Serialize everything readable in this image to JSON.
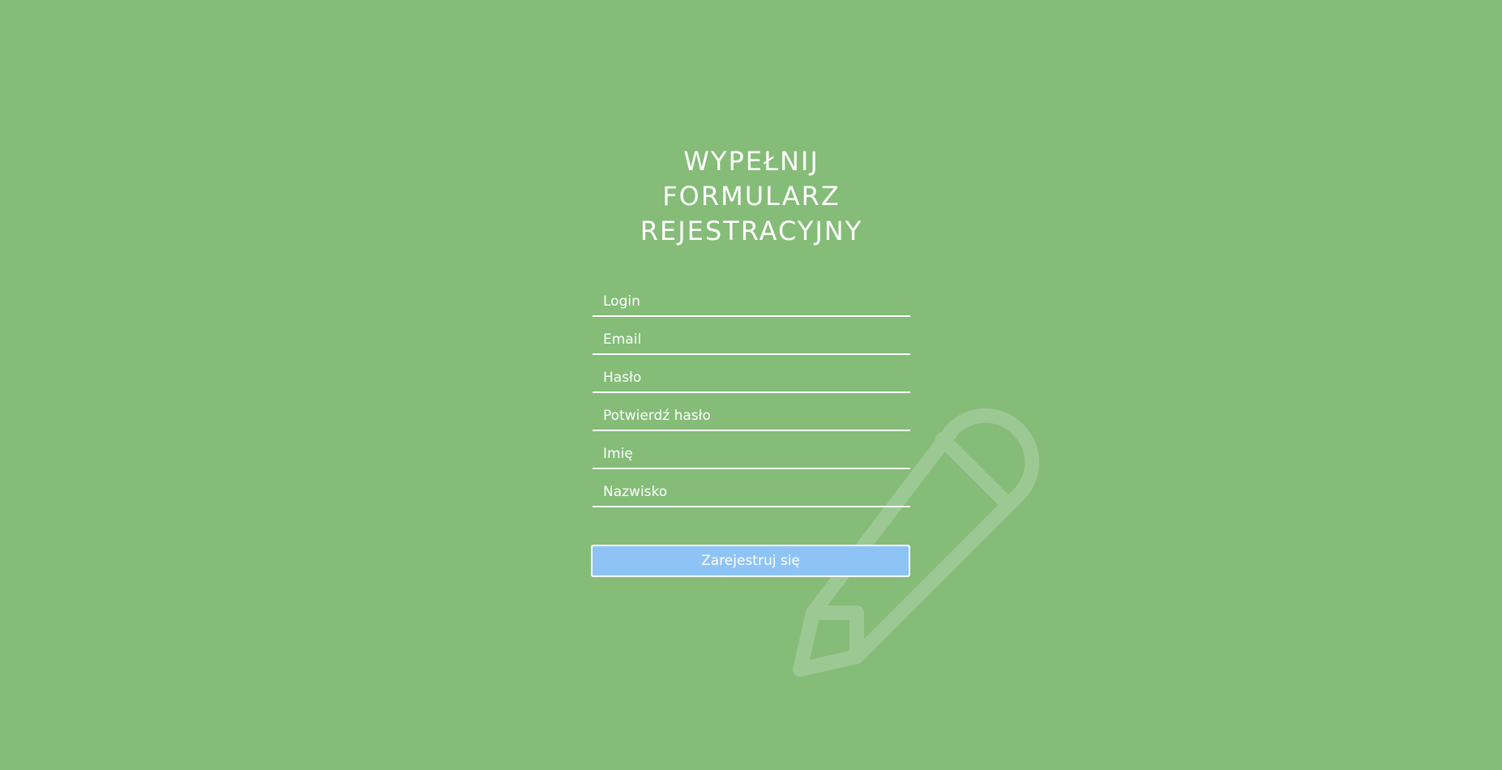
{
  "background_color": "#84bc78",
  "decoration_icon": "pencil-icon",
  "form": {
    "title_line1": "WYPEŁNIJ FORMULARZ",
    "title_line2": "REJESTRACYJNY",
    "fields": [
      {
        "placeholder": "Login",
        "value": ""
      },
      {
        "placeholder": "Email",
        "value": ""
      },
      {
        "placeholder": "Hasło",
        "value": ""
      },
      {
        "placeholder": "Potwierdź hasło",
        "value": ""
      },
      {
        "placeholder": "Imię",
        "value": ""
      },
      {
        "placeholder": "Nazwisko",
        "value": ""
      }
    ],
    "submit_label": "Zarejestruj się",
    "submit_color": "#8ec4f5"
  }
}
